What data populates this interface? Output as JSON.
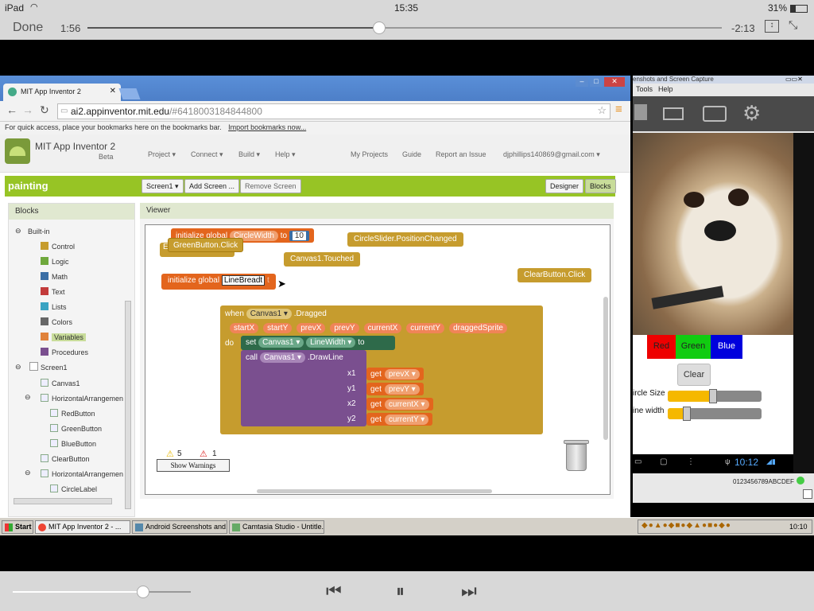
{
  "ipad": {
    "device": "iPad",
    "time": "15:35",
    "battery": "31%"
  },
  "player": {
    "done_label": "Done",
    "elapsed": "1:56",
    "remaining": "-2:13",
    "progress_fraction": 0.46,
    "volume_fraction": 0.73
  },
  "browser": {
    "tab_title": "MIT App Inventor 2",
    "url_host": "ai2.appinventor.mit.edu",
    "url_path": "/#6418003184844800",
    "bookmarks_hint": "For quick access, place your bookmarks here on the bookmarks bar.",
    "import_link": "Import bookmarks now..."
  },
  "app": {
    "name": "MIT App Inventor 2",
    "badge": "Beta",
    "menus": [
      "Project ▾",
      "Connect ▾",
      "Build ▾",
      "Help ▾"
    ],
    "links": [
      "My Projects",
      "Guide",
      "Report an Issue",
      "djphillips140869@gmail.com ▾"
    ],
    "project_name": "painting",
    "screen_select": "Screen1 ▾",
    "add_screen": "Add Screen ...",
    "remove_screen": "Remove Screen",
    "designer": "Designer",
    "blocks": "Blocks"
  },
  "blocks_panel": {
    "title": "Blocks",
    "builtin": "Built-in",
    "builtin_items": [
      {
        "label": "Control",
        "color": "#c69c2e"
      },
      {
        "label": "Logic",
        "color": "#6fa83c"
      },
      {
        "label": "Math",
        "color": "#3a6ea5"
      },
      {
        "label": "Text",
        "color": "#c23b3b"
      },
      {
        "label": "Lists",
        "color": "#3aa3c2"
      },
      {
        "label": "Colors",
        "color": "#666666"
      },
      {
        "label": "Variables",
        "color": "#e0823a"
      },
      {
        "label": "Procedures",
        "color": "#7a4f8f"
      }
    ],
    "screen": "Screen1",
    "components": [
      "Canvas1",
      "HorizontalArrangemen",
      "RedButton",
      "GreenButton",
      "BlueButton",
      "ClearButton",
      "HorizontalArrangemen",
      "CircleLabel"
    ]
  },
  "viewer": {
    "title": "Viewer",
    "init1_label": "initialize global",
    "init1_name": "CircleWidth",
    "init1_to": "to",
    "init1_value": "10",
    "green_click": "GreenButton.Click",
    "circle_slider": "CircleSlider.PositionChanged",
    "canvas_touched": "Canvas1.Touched",
    "init2_label": "initialize global",
    "init2_name": "LineBreadt",
    "clear_click": "ClearButton.Click",
    "when": "when",
    "canvas_select": "Canvas1 ▾",
    "dragged": ".Dragged",
    "params": [
      "startX",
      "startY",
      "prevX",
      "prevY",
      "currentX",
      "currentY",
      "draggedSprite"
    ],
    "do": "do",
    "set": "set",
    "set_canvas": "Canvas1 ▾",
    "set_prop": "LineWidth ▾",
    "set_to": "to",
    "call": "call",
    "call_canvas": "Canvas1 ▾",
    "drawline": ".DrawLine",
    "args": [
      {
        "name": "x1",
        "get": "get",
        "var": "prevX ▾"
      },
      {
        "name": "y1",
        "get": "get",
        "var": "prevY ▾"
      },
      {
        "name": "x2",
        "get": "get",
        "var": "currentX ▾"
      },
      {
        "name": "y2",
        "get": "get",
        "var": "currentY ▾"
      }
    ],
    "warnings_count": "5",
    "errors_count": "1",
    "show_warnings": "Show Warnings"
  },
  "capture": {
    "title": "enshots and Screen Capture",
    "menu_tools": "Tools",
    "menu_help": "Help",
    "red": "Red",
    "green": "Green",
    "blue": "Blue",
    "clear": "Clear",
    "circle_size": "ircle Size",
    "line_width": "ine width",
    "circle_slider_fraction": 0.48,
    "line_slider_fraction": 0.2,
    "android_time": "10:12",
    "serial": "0123456789ABCDEF"
  },
  "taskbar": {
    "start": "Start",
    "items": [
      "MIT App Inventor 2 - ...",
      "Android Screenshots and...",
      "Camtasia Studio - Untitle..."
    ],
    "clock": "10:10"
  }
}
